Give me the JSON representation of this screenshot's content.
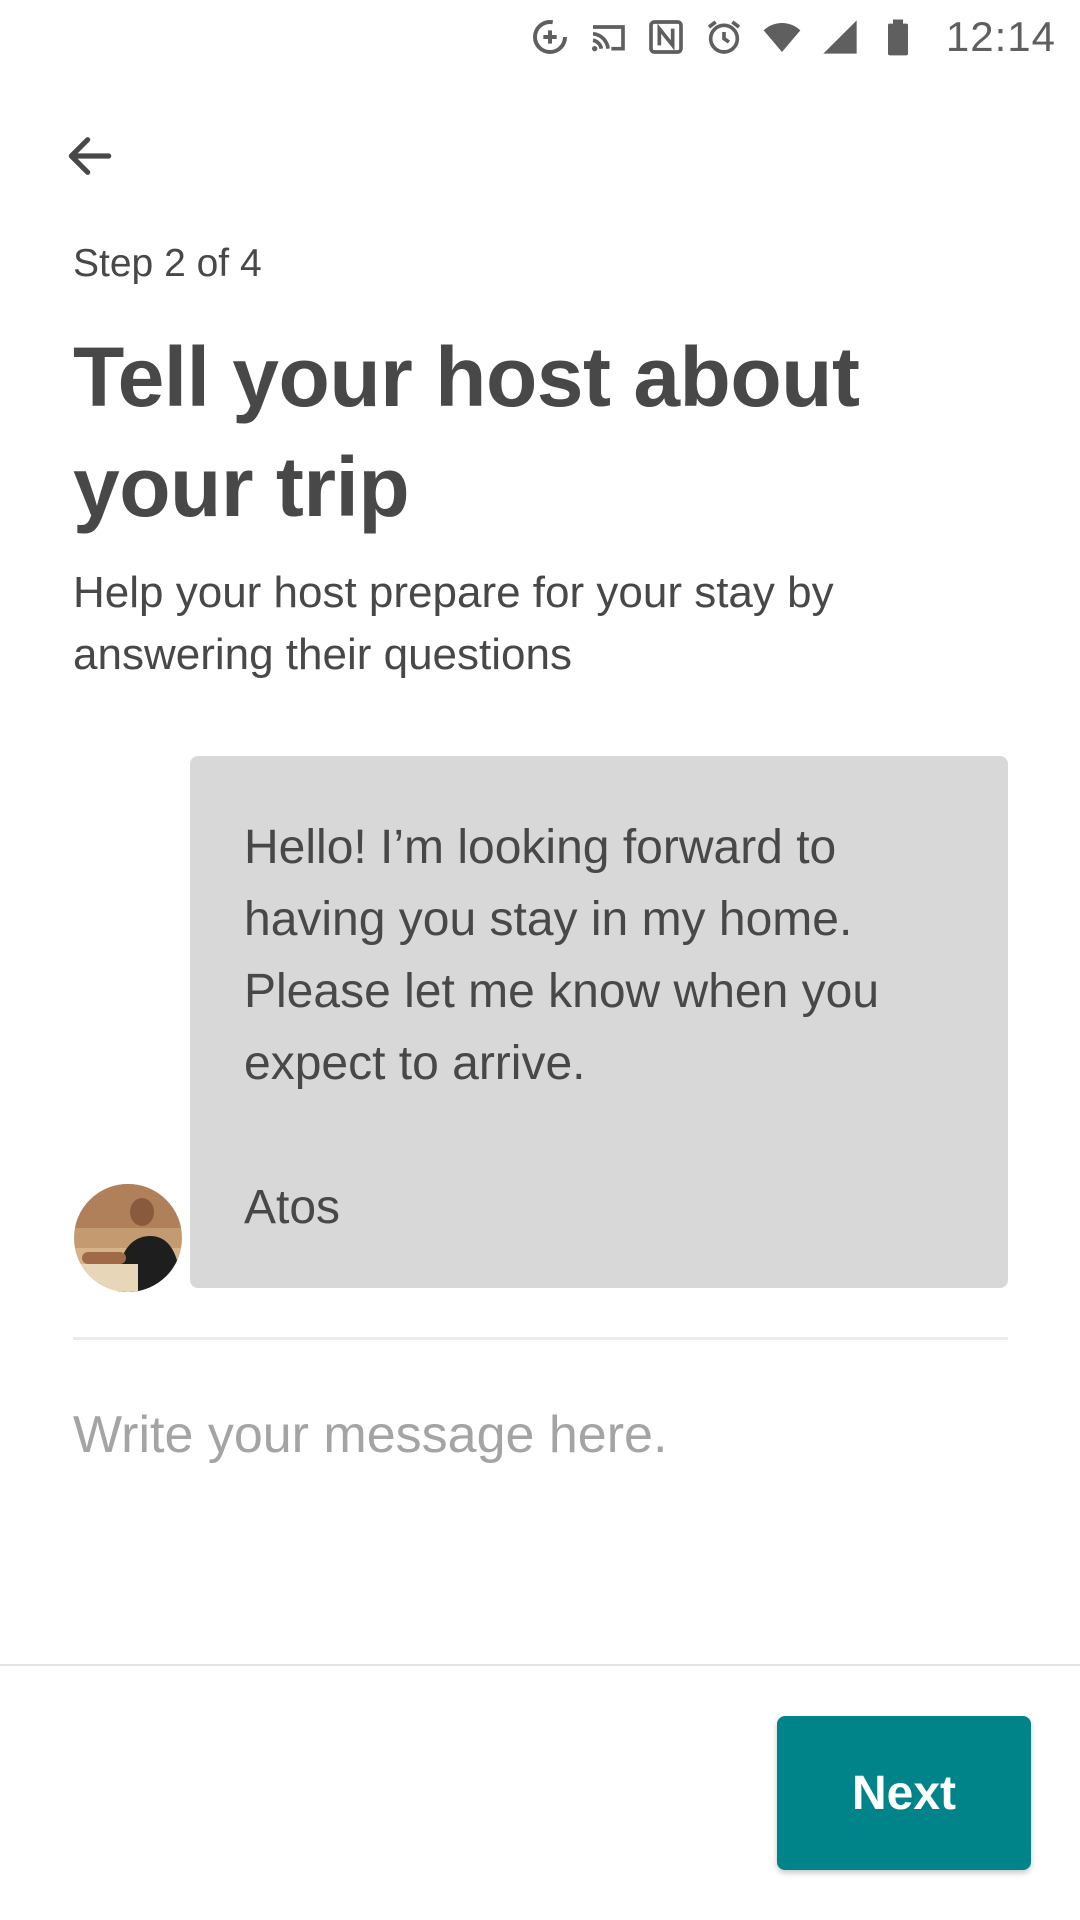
{
  "status_bar": {
    "time": "12:14",
    "icons": [
      "data-saver-icon",
      "cast-icon",
      "nfc-icon",
      "alarm-icon",
      "wifi-icon",
      "cell-signal-icon",
      "battery-icon"
    ]
  },
  "header": {
    "back_icon": "arrow-left-icon",
    "step": "Step 2 of 4",
    "title": "Tell your host about your trip",
    "subtitle": "Help your host prepare for your stay by answering their questions"
  },
  "host_message": {
    "text": "Hello! I’m looking forward to having you stay in my home. Please let me know when you expect to arrive.",
    "signature": "Atos"
  },
  "message_input": {
    "placeholder": "Write your message here.",
    "value": ""
  },
  "footer": {
    "next_label": "Next"
  },
  "colors": {
    "accent": "#008489",
    "text": "#484848",
    "bubble": "#d8d8d8",
    "placeholder": "#a4a4a4"
  }
}
